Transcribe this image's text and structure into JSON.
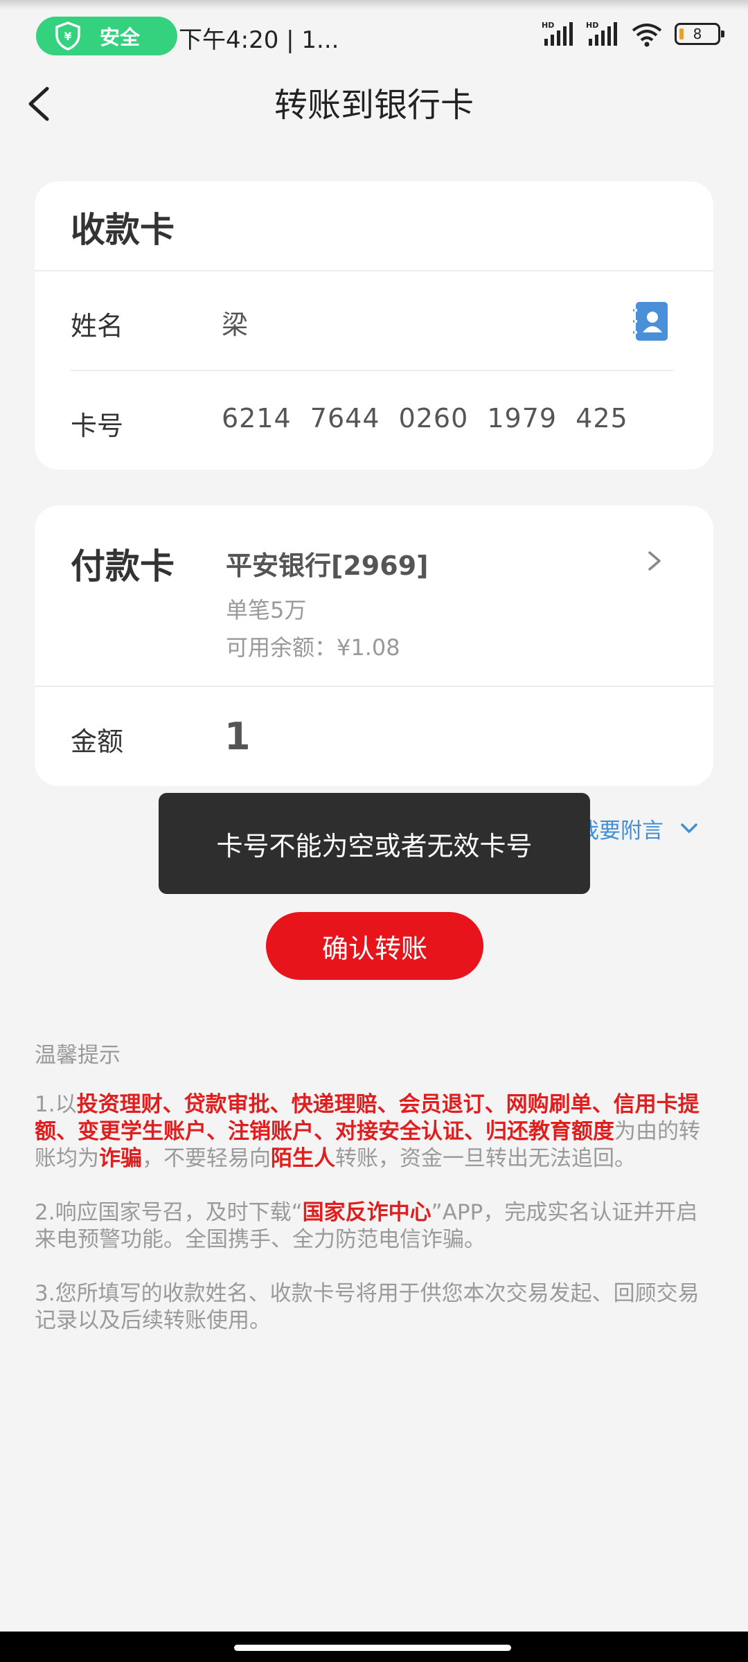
{
  "status_bar": {
    "safe_label": "安全",
    "time": "下午4:20 | 1...",
    "signal1": "HD",
    "signal2": "HD",
    "battery": "8"
  },
  "header": {
    "title": "转账到银行卡"
  },
  "recipient_card": {
    "title": "收款卡",
    "name_label": "姓名",
    "name_value": "梁",
    "card_label": "卡号",
    "card_value": "6214 7644 0260 1979 425"
  },
  "payment_card": {
    "title": "付款卡",
    "bank_name": "平安银行[2969]",
    "limit": "单笔5万",
    "balance": "可用余额：¥1.08",
    "amount_label": "金额",
    "amount_value": "1"
  },
  "remark": {
    "label": "我要附言"
  },
  "toast": {
    "message": "卡号不能为空或者无效卡号"
  },
  "confirm": {
    "label": "确认转账"
  },
  "tips": {
    "title": "温馨提示",
    "tip1": {
      "prefix": "1.以",
      "red1": "投资理财、贷款审批、快递理赔、会员退订、网购刷单、信用卡提额、变更学生账户、注销账户、对接安全认证、归还教育额度",
      "mid1": "为由的转账均为",
      "red2": "诈骗",
      "mid2": "，不要轻易向",
      "red3": "陌生人",
      "suffix": "转账，资金一旦转出无法追回。"
    },
    "tip2": {
      "prefix": "2.响应国家号召，及时下载“",
      "red": "国家反诈中心",
      "suffix": "”APP，完成实名认证并开启来电预警功能。全国携手、全力防范电信诈骗。"
    },
    "tip3": "3.您所填写的收款姓名、收款卡号将用于供您本次交易发起、回顾交易记录以及后续转账使用。"
  },
  "colors": {
    "accent_red": "#e8141c",
    "safe_green": "#34d27e",
    "link_blue": "#3f8fd8",
    "contact_blue": "#4a90d8"
  }
}
